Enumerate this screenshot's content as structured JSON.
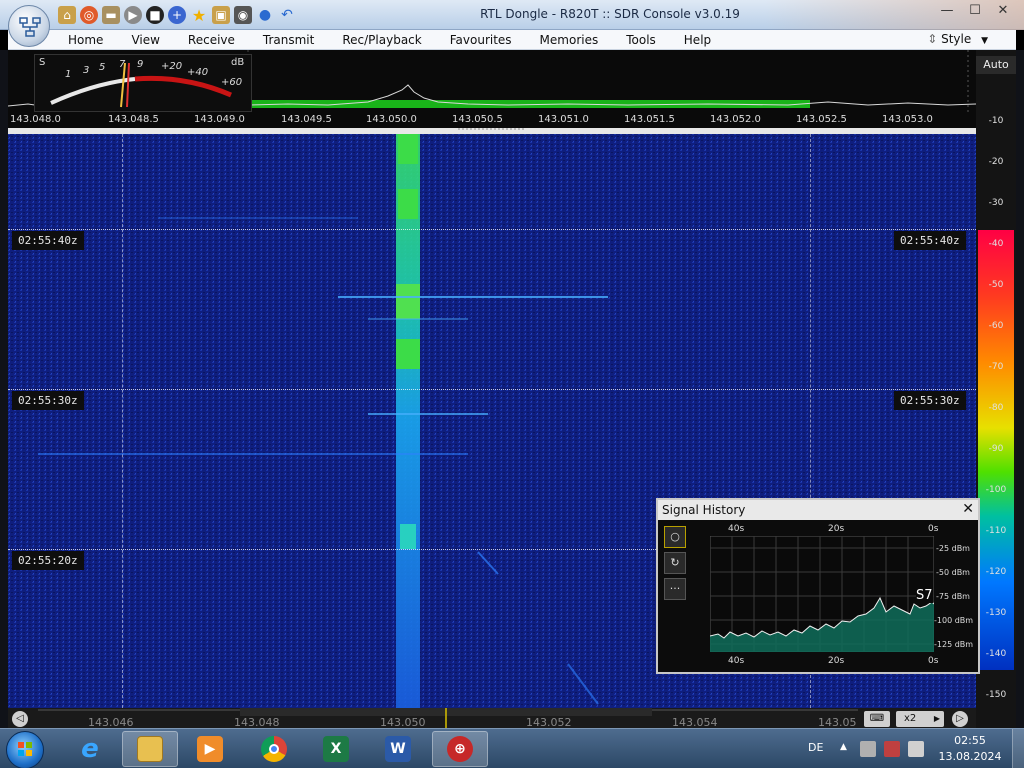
{
  "window": {
    "title": "RTL Dongle - R820T :: SDR Console v3.0.19",
    "controls": {
      "minimize": "—",
      "maximize": "☐",
      "close": "✕"
    }
  },
  "quick_access": [
    "home-icon",
    "lifebuoy-icon",
    "folder-icon",
    "play-icon",
    "stop-icon",
    "plus-icon",
    "star-icon",
    "lock-icon",
    "camera-icon",
    "drop-icon",
    "undo-icon"
  ],
  "menu": {
    "items": [
      "Home",
      "View",
      "Receive",
      "Transmit",
      "Rec/Playback",
      "Favourites",
      "Memories",
      "Tools",
      "Help"
    ],
    "style_label": "Style"
  },
  "smeter": {
    "s_label": "S",
    "db_label": "dB",
    "s_scale": [
      "1",
      "3",
      "5",
      "7",
      "9"
    ],
    "db_scale": [
      "+20",
      "+40",
      "+60"
    ]
  },
  "spectrum": {
    "freq_labels": [
      "143.048.0",
      "143.048.5",
      "143.049.0",
      "143.049.5",
      "143.050.0",
      "143.050.5",
      "143.051.0",
      "143.051.5",
      "143.052.0",
      "143.052.5",
      "143.053.0"
    ]
  },
  "scale": {
    "auto_label": "Auto",
    "ticks": [
      "-10",
      "-20",
      "-30",
      "-40",
      "-50",
      "-60",
      "-70",
      "-80",
      "-90",
      "-100",
      "-110",
      "-120",
      "-130",
      "-140",
      "-150"
    ]
  },
  "waterfall": {
    "time_labels": [
      "02:55:40z",
      "02:55:30z",
      "02:55:20z"
    ]
  },
  "bottom_bar": {
    "freqs": [
      "143.046",
      "143.048",
      "143.050",
      "143.052",
      "143.054",
      "143.05"
    ],
    "zoom_label": "x2"
  },
  "signal_history": {
    "title": "Signal History",
    "close": "✕",
    "x_labels": [
      "40s",
      "20s",
      "0s"
    ],
    "y_labels": [
      "-25 dBm",
      "-50 dBm",
      "-75 dBm",
      "-100 dBm",
      "-125 dBm"
    ],
    "s_reading": "S7",
    "side_buttons": [
      "○",
      "↻",
      "···"
    ]
  },
  "taskbar": {
    "apps": [
      "explorer-icon",
      "internet-explorer-icon",
      "file-manager-icon",
      "media-player-icon",
      "chrome-icon",
      "excel-icon",
      "word-icon",
      "sdr-console-icon"
    ],
    "language": "DE",
    "time": "02:55",
    "date": "13.08.2024"
  },
  "colors": {
    "waterfall_bg": "#0e1d7a",
    "signal": "#00e0c0",
    "accent_green": "#19b319"
  }
}
